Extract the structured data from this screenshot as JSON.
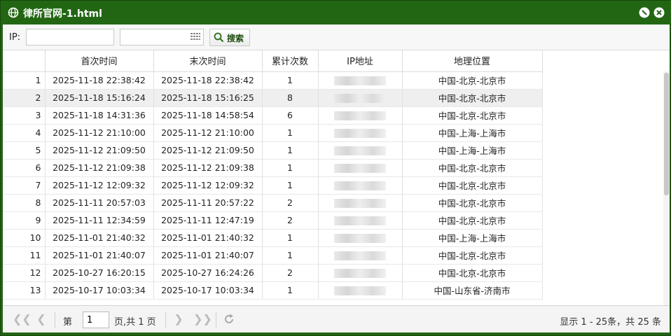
{
  "window": {
    "title": "律所官网-1.html"
  },
  "toolbar": {
    "ip_label": "IP:",
    "ip_value": "",
    "date_value": "",
    "search_label": "搜索"
  },
  "table": {
    "columns": [
      "",
      "首次时间",
      "末次时间",
      "累计次数",
      "IP地址",
      "地理位置"
    ],
    "rows": [
      {
        "n": "1",
        "first": "2025-11-18 22:38:42",
        "last": "2025-11-18 22:38:42",
        "count": "1",
        "geo": "中国-北京-北京市"
      },
      {
        "n": "2",
        "first": "2025-11-18 15:16:24",
        "last": "2025-11-18 15:16:25",
        "count": "8",
        "geo": "中国-北京-北京市"
      },
      {
        "n": "3",
        "first": "2025-11-18 14:31:36",
        "last": "2025-11-18 14:58:54",
        "count": "6",
        "geo": "中国-北京-北京市"
      },
      {
        "n": "4",
        "first": "2025-11-12 21:10:00",
        "last": "2025-11-12 21:10:00",
        "count": "1",
        "geo": "中国-上海-上海市"
      },
      {
        "n": "5",
        "first": "2025-11-12 21:09:50",
        "last": "2025-11-12 21:09:50",
        "count": "1",
        "geo": "中国-上海-上海市"
      },
      {
        "n": "6",
        "first": "2025-11-12 21:09:38",
        "last": "2025-11-12 21:09:38",
        "count": "1",
        "geo": "中国-北京-北京市"
      },
      {
        "n": "7",
        "first": "2025-11-12 12:09:32",
        "last": "2025-11-12 12:09:32",
        "count": "1",
        "geo": "中国-北京-北京市"
      },
      {
        "n": "8",
        "first": "2025-11-11 20:57:03",
        "last": "2025-11-11 20:57:22",
        "count": "2",
        "geo": "中国-北京-北京市"
      },
      {
        "n": "9",
        "first": "2025-11-11 12:34:59",
        "last": "2025-11-11 12:47:19",
        "count": "2",
        "geo": "中国-北京-北京市"
      },
      {
        "n": "10",
        "first": "2025-11-01 21:40:32",
        "last": "2025-11-01 21:40:32",
        "count": "1",
        "geo": "中国-上海-上海市"
      },
      {
        "n": "11",
        "first": "2025-11-01 21:40:07",
        "last": "2025-11-01 21:40:07",
        "count": "1",
        "geo": "中国-北京-北京市"
      },
      {
        "n": "12",
        "first": "2025-10-27 16:20:15",
        "last": "2025-10-27 16:24:26",
        "count": "2",
        "geo": "中国-北京-北京市"
      },
      {
        "n": "13",
        "first": "2025-10-17 10:03:34",
        "last": "2025-10-17 10:03:34",
        "count": "1",
        "geo": "中国-山东省-济南市"
      }
    ],
    "selected_row": 1
  },
  "pager": {
    "page_prefix": "第",
    "page_value": "1",
    "page_suffix": "页,共 1 页",
    "info": "显示 1 - 25条，共 25 条"
  },
  "colors": {
    "titlebar": "#226614",
    "selected_row": "#efefef"
  }
}
